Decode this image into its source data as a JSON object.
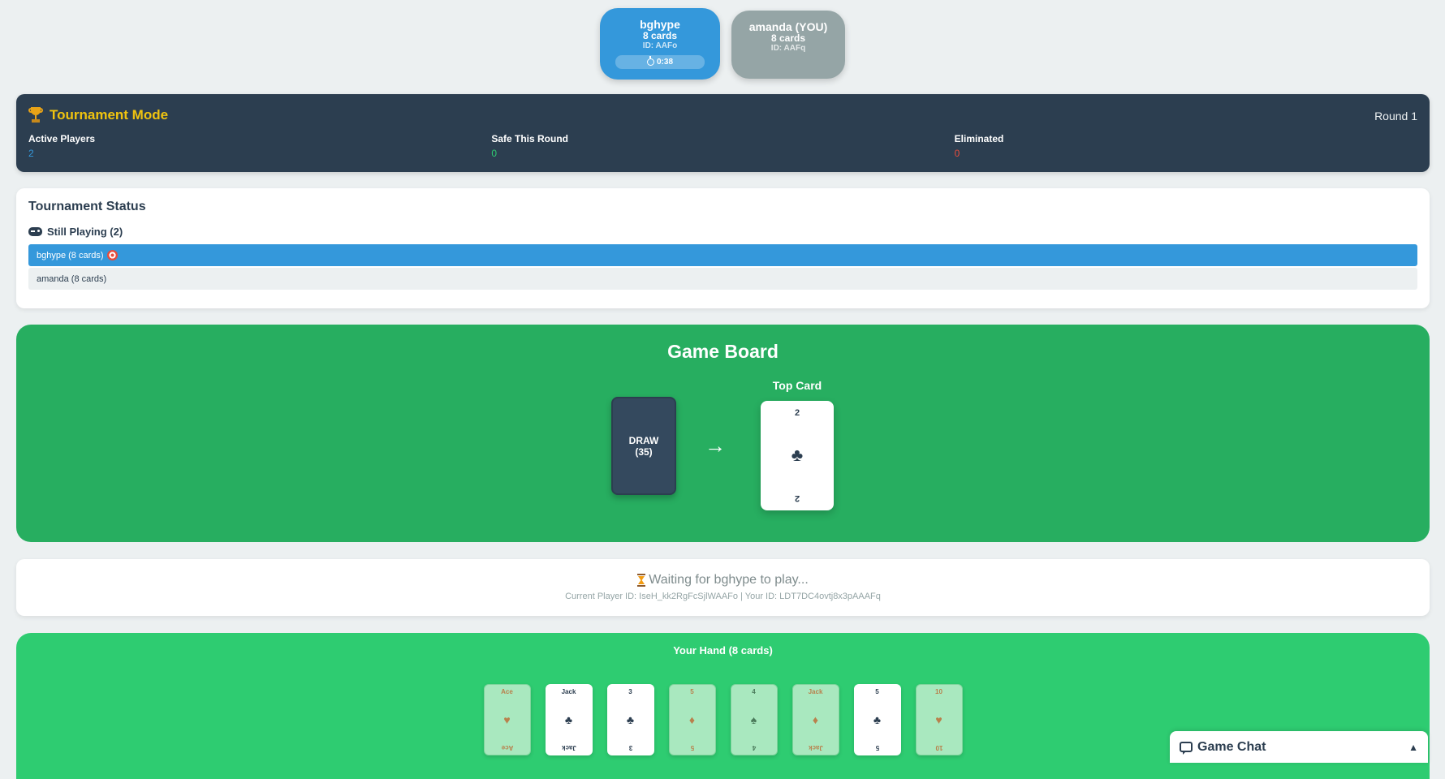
{
  "players": [
    {
      "name": "bghype",
      "cards": "8 cards",
      "id": "ID: AAFo",
      "timer": "0:38",
      "active": true
    },
    {
      "name": "amanda (YOU)",
      "cards": "8 cards",
      "id": "ID: AAFq",
      "active": false
    }
  ],
  "tournament": {
    "title": "Tournament Mode",
    "round": "Round 1",
    "stats": [
      {
        "label": "Active Players",
        "value": "2"
      },
      {
        "label": "Safe This Round",
        "value": "0"
      },
      {
        "label": "Eliminated",
        "value": "0"
      }
    ]
  },
  "status": {
    "title": "Tournament Status",
    "still_playing": "Still Playing (2)",
    "rows": [
      "bghype (8 cards)",
      "amanda (8 cards)"
    ]
  },
  "board": {
    "title": "Game Board",
    "draw_label": "DRAW",
    "draw_count": "(35)",
    "arrow": "→",
    "top_card_label": "Top Card",
    "top_card": {
      "rank": "2",
      "suit": "♣"
    }
  },
  "waiting": {
    "message": "Waiting for bghype to play...",
    "ids": "Current Player ID: IseH_kk2RgFcSjlWAAFo | Your ID: LDT7DC4ovtj8x3pAAAFq"
  },
  "hand": {
    "title": "Your Hand (8 cards)",
    "cards": [
      {
        "rank": "Ace",
        "suit": "♥",
        "playable": true,
        "color": "red"
      },
      {
        "rank": "Jack",
        "suit": "♣",
        "playable": false,
        "color": "black"
      },
      {
        "rank": "3",
        "suit": "♣",
        "playable": false,
        "color": "black"
      },
      {
        "rank": "5",
        "suit": "♦",
        "playable": true,
        "color": "red"
      },
      {
        "rank": "4",
        "suit": "♠",
        "playable": true,
        "color": "black"
      },
      {
        "rank": "Jack",
        "suit": "♦",
        "playable": true,
        "color": "red"
      },
      {
        "rank": "5",
        "suit": "♣",
        "playable": false,
        "color": "black"
      },
      {
        "rank": "10",
        "suit": "♥",
        "playable": true,
        "color": "red"
      }
    ]
  },
  "chat": {
    "title": "Game Chat",
    "toggle": "▲"
  },
  "colors": {
    "active_player": "#3498db",
    "board": "#27ae60",
    "hand": "#2ecc71",
    "header": "#2c3e50",
    "title_accent": "#f1c40f"
  }
}
